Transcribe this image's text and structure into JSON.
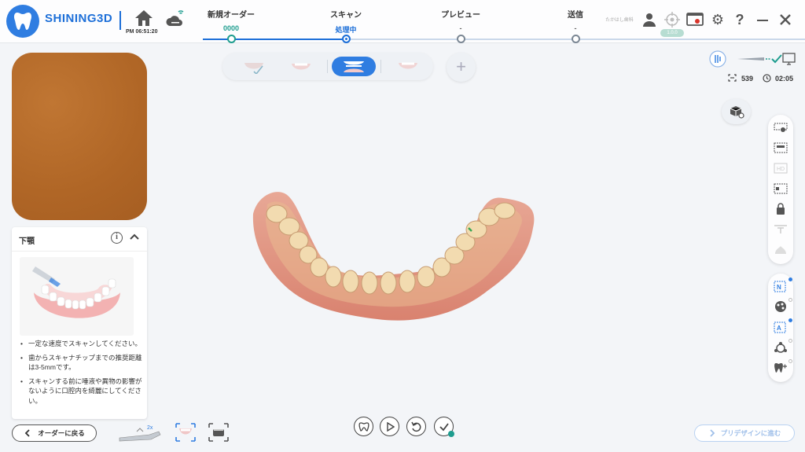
{
  "app": {
    "brand": "SHINING3D",
    "clock": "PM 06:51:20"
  },
  "steps": [
    {
      "title": "新規オーダー",
      "value": "0000"
    },
    {
      "title": "スキャン",
      "value": "処理中"
    },
    {
      "title": "プレビュー",
      "value": "-"
    },
    {
      "title": "送信",
      "value": "-"
    }
  ],
  "header_right": {
    "user_name": "たかはし歯科",
    "badge": "1.0.0"
  },
  "scan_tabs": [
    "上顎",
    "下顎",
    "咬合",
    "追加"
  ],
  "guide": {
    "title": "下顎",
    "tips": [
      "一定な速度でスキャンしてください。",
      "歯からスキャナチップまでの推奨距離は3-5mmです。",
      "スキャンする前に唾液や異物の影響がないように口腔内を綺麗にしてください。"
    ]
  },
  "status": {
    "count": "539",
    "elapsed": "02:05"
  },
  "bottom": {
    "back_label": "オーダーに戻る",
    "next_label": "プリデザインに進む",
    "scanner_mult": "2x"
  },
  "colors": {
    "accent": "#2f7de1",
    "teal": "#1e9d8f",
    "camera": "#b56a2a"
  }
}
